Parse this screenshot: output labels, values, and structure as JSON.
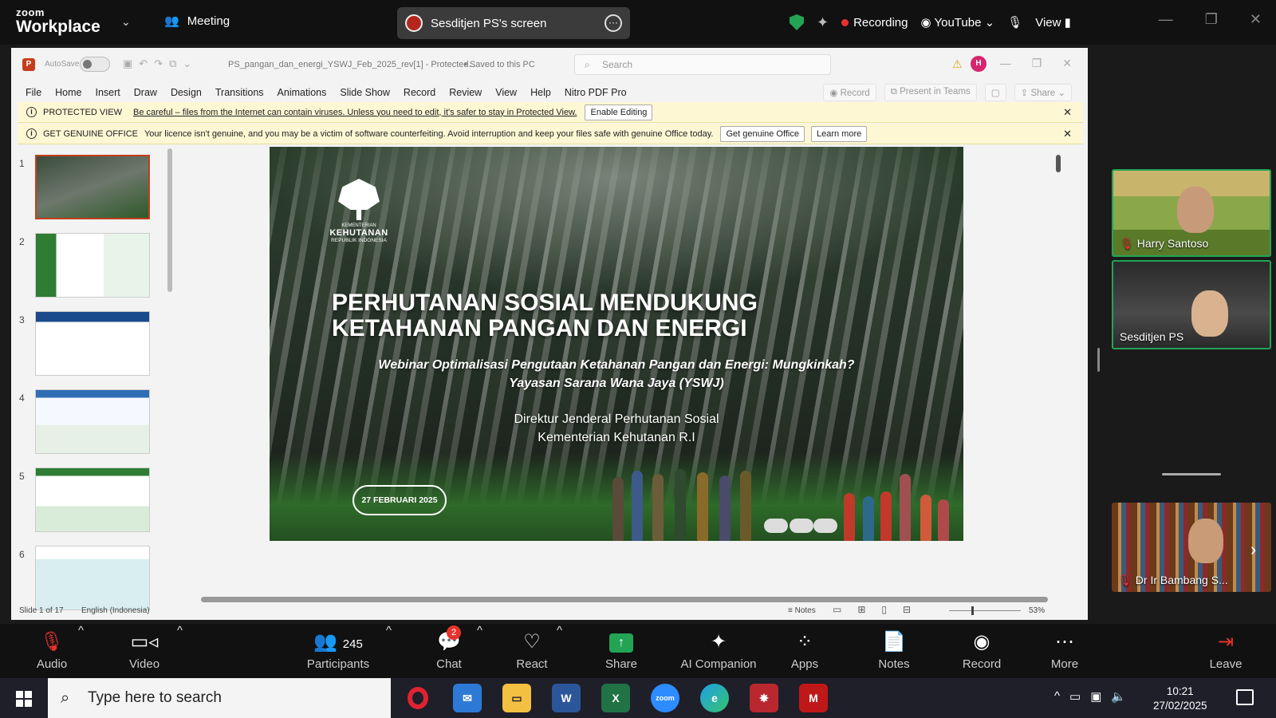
{
  "zoom": {
    "brand_top": "zoom",
    "brand_bottom": "Workplace",
    "meeting_label": "Meeting",
    "screen_share_label": "Sesditjen PS's screen",
    "recording_label": "Recording",
    "youtube_label": "YouTube",
    "view_label": "View",
    "toolbar": {
      "audio": "Audio",
      "video": "Video",
      "participants": "Participants",
      "participants_count": "245",
      "chat": "Chat",
      "chat_badge": "2",
      "react": "React",
      "share": "Share",
      "ai_companion": "AI Companion",
      "apps": "Apps",
      "notes": "Notes",
      "record": "Record",
      "more": "More",
      "leave": "Leave"
    }
  },
  "ppt": {
    "autosave": "AutoSave",
    "filename": "PS_pangan_dan_energi_YSWJ_Feb_2025_rev[1] - Protected...",
    "saved": "• Saved to this PC",
    "search_placeholder": "Search",
    "user_initial": "H",
    "menu": [
      "File",
      "Home",
      "Insert",
      "Draw",
      "Design",
      "Transitions",
      "Animations",
      "Slide Show",
      "Record",
      "Review",
      "View",
      "Help",
      "Nitro PDF Pro"
    ],
    "ribbon_right": {
      "record": "Record",
      "present": "Present in Teams",
      "share": "Share"
    },
    "protected_bar": {
      "name": "PROTECTED VIEW",
      "message": "Be careful – files from the Internet can contain viruses. Unless you need to edit, it's safer to stay in Protected View.",
      "button": "Enable Editing"
    },
    "genuine_bar": {
      "name": "GET GENUINE OFFICE",
      "message": "Your licence isn't genuine, and you may be a victim of software counterfeiting. Avoid interruption and keep your files safe with genuine Office today.",
      "button1": "Get genuine Office",
      "button2": "Learn more"
    },
    "thumbnails": [
      "1",
      "2",
      "3",
      "4",
      "5",
      "6"
    ],
    "slide": {
      "logo_line1": "KEMENTERIAN",
      "logo_line2": "KEHUTANAN",
      "logo_line3": "REPUBLIK INDONESIA",
      "title_line1": "PERHUTANAN SOSIAL MENDUKUNG",
      "title_line2": "KETAHANAN PANGAN DAN ENERGI",
      "subtitle_line1": "Webinar Optimalisasi Pengutaan Ketahanan Pangan dan Energi: Mungkinkah?",
      "subtitle_line2": "Yayasan Sarana Wana Jaya (YSWJ)",
      "director_line1": "Direktur Jenderal Perhutanan Sosial",
      "director_line2": "Kementerian Kehutanan R.I",
      "date": "27 FEBRUARI 2025"
    },
    "status": {
      "slide_count": "Slide 1 of 17",
      "language": "English (Indonesia)",
      "notes": "Notes",
      "zoom": "53%"
    }
  },
  "participants": [
    {
      "name": "Harry Santoso"
    },
    {
      "name": "Sesditjen PS"
    },
    {
      "name": "Dr Ir Bambang S..."
    }
  ],
  "taskbar": {
    "search_placeholder": "Type here to search",
    "time": "10:21",
    "date": "27/02/2025"
  }
}
